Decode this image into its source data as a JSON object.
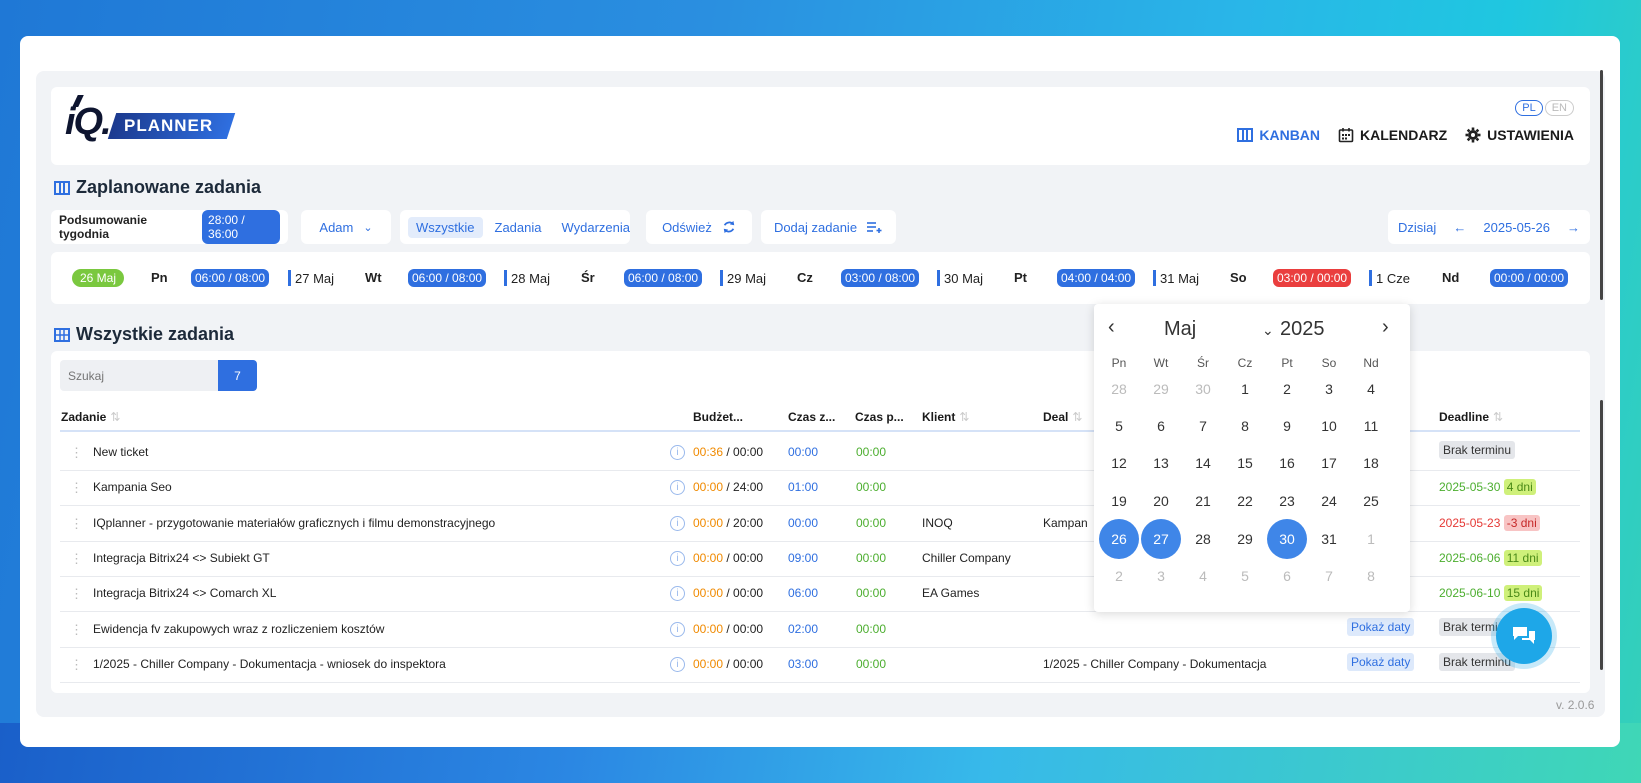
{
  "header": {
    "logo_text": "iQ.",
    "logo_badge": "PLANNER",
    "lang": [
      "PL",
      "EN"
    ],
    "nav": [
      {
        "label": "KANBAN",
        "icon": "kanban-icon"
      },
      {
        "label": "KALENDARZ",
        "icon": "calendar-icon"
      },
      {
        "label": "USTAWIENIA",
        "icon": "gear-icon"
      }
    ]
  },
  "planned": {
    "title": "Zaplanowane zadania",
    "week_summary_label": "Podsumowanie tygodnia",
    "week_summary_value": "28:00 / 36:00",
    "user": "Adam",
    "filters": [
      "Wszystkie",
      "Zadania",
      "Wydarzenia"
    ],
    "refresh": "Odśwież",
    "add_task": "Dodaj zadanie",
    "today": "Dzisiaj",
    "date": "2025-05-26"
  },
  "days": [
    {
      "date": "26 Maj",
      "name": "Pn",
      "hours": "06:00 / 08:00"
    },
    {
      "date": "27 Maj",
      "name": "Wt",
      "hours": "06:00 / 08:00"
    },
    {
      "date": "28 Maj",
      "name": "Śr",
      "hours": "06:00 / 08:00"
    },
    {
      "date": "29 Maj",
      "name": "Cz",
      "hours": "03:00 / 08:00"
    },
    {
      "date": "30 Maj",
      "name": "Pt",
      "hours": "04:00 / 04:00"
    },
    {
      "date": "31 Maj",
      "name": "So",
      "hours": "03:00 / 00:00"
    },
    {
      "date": "1 Cze",
      "name": "Nd",
      "hours": "00:00 / 00:00"
    }
  ],
  "all": {
    "title": "Wszystkie zadania",
    "search_placeholder": "Szukaj",
    "count": "7",
    "columns": [
      "Zadanie",
      "Budżet...",
      "Czas z...",
      "Czas p...",
      "Klient",
      "Deal",
      "Deadline"
    ],
    "rows": [
      {
        "name": "New ticket",
        "used": "00:36",
        "budget": "00:00",
        "cz": "00:00",
        "cp": "00:00",
        "client": "",
        "deal": "",
        "pokaz": "",
        "deadline": "",
        "deadline_tag": "Brak terminu",
        "tag_type": "none"
      },
      {
        "name": "Kampania Seo",
        "used": "00:00",
        "budget": "24:00",
        "cz": "01:00",
        "cp": "00:00",
        "client": "",
        "deal": "",
        "pokaz": "",
        "deadline": "2025-05-30",
        "deadline_tag": "4 dni",
        "tag_type": "g"
      },
      {
        "name": "IQplanner - przygotowanie materiałów graficznych i filmu demonstracyjnego",
        "used": "00:00",
        "budget": "20:00",
        "cz": "00:00",
        "cp": "00:00",
        "client": "INOQ",
        "deal": "Kampan",
        "pokaz": "",
        "deadline": "2025-05-23",
        "deadline_tag": "-3 dni",
        "tag_type": "r"
      },
      {
        "name": "Integracja Bitrix24 <> Subiekt GT",
        "used": "00:00",
        "budget": "00:00",
        "cz": "09:00",
        "cp": "00:00",
        "client": "Chiller Company",
        "deal": "",
        "pokaz": "",
        "deadline": "2025-06-06",
        "deadline_tag": "11 dni",
        "tag_type": "g"
      },
      {
        "name": "Integracja Bitrix24 <> Comarch XL",
        "used": "00:00",
        "budget": "00:00",
        "cz": "06:00",
        "cp": "00:00",
        "client": "EA Games",
        "deal": "",
        "pokaz": "",
        "deadline": "2025-06-10",
        "deadline_tag": "15 dni",
        "tag_type": "g"
      },
      {
        "name": "Ewidencja fv zakupowych wraz z rozliczeniem kosztów",
        "used": "00:00",
        "budget": "00:00",
        "cz": "02:00",
        "cp": "00:00",
        "client": "",
        "deal": "",
        "pokaz": "Pokaż daty",
        "deadline": "",
        "deadline_tag": "Brak termi",
        "tag_type": "none"
      },
      {
        "name": "1/2025 - Chiller Company - Dokumentacja - wniosek do inspektora",
        "used": "00:00",
        "budget": "00:00",
        "cz": "03:00",
        "cp": "00:00",
        "client": "",
        "deal": "1/2025 - Chiller Company - Dokumentacja",
        "pokaz": "Pokaż daty",
        "deadline": "",
        "deadline_tag": "Brak terminu",
        "tag_type": "none"
      }
    ]
  },
  "calendar": {
    "month": "Maj",
    "year": "2025",
    "weekdays": [
      "Pn",
      "Wt",
      "Śr",
      "Cz",
      "Pt",
      "So",
      "Nd"
    ],
    "weeks": [
      [
        "28",
        "29",
        "30",
        "1",
        "2",
        "3",
        "4"
      ],
      [
        "5",
        "6",
        "7",
        "8",
        "9",
        "10",
        "11"
      ],
      [
        "12",
        "13",
        "14",
        "15",
        "16",
        "17",
        "18"
      ],
      [
        "19",
        "20",
        "21",
        "22",
        "23",
        "24",
        "25"
      ],
      [
        "26",
        "27",
        "28",
        "29",
        "30",
        "31",
        "1"
      ],
      [
        "2",
        "3",
        "4",
        "5",
        "6",
        "7",
        "8"
      ]
    ],
    "muted": [
      [
        0,
        0
      ],
      [
        0,
        1
      ],
      [
        0,
        2
      ],
      [
        4,
        6
      ],
      [
        5,
        0
      ],
      [
        5,
        1
      ],
      [
        5,
        2
      ],
      [
        5,
        3
      ],
      [
        5,
        4
      ],
      [
        5,
        5
      ],
      [
        5,
        6
      ]
    ],
    "selected": [
      [
        4,
        0
      ],
      [
        4,
        1
      ],
      [
        4,
        4
      ]
    ]
  },
  "version": "v. 2.0.6",
  "colors": {
    "accent": "#2f6fe0",
    "red": "#ea3e3e",
    "green": "#7ac83f",
    "fab": "#1ea7e8"
  }
}
